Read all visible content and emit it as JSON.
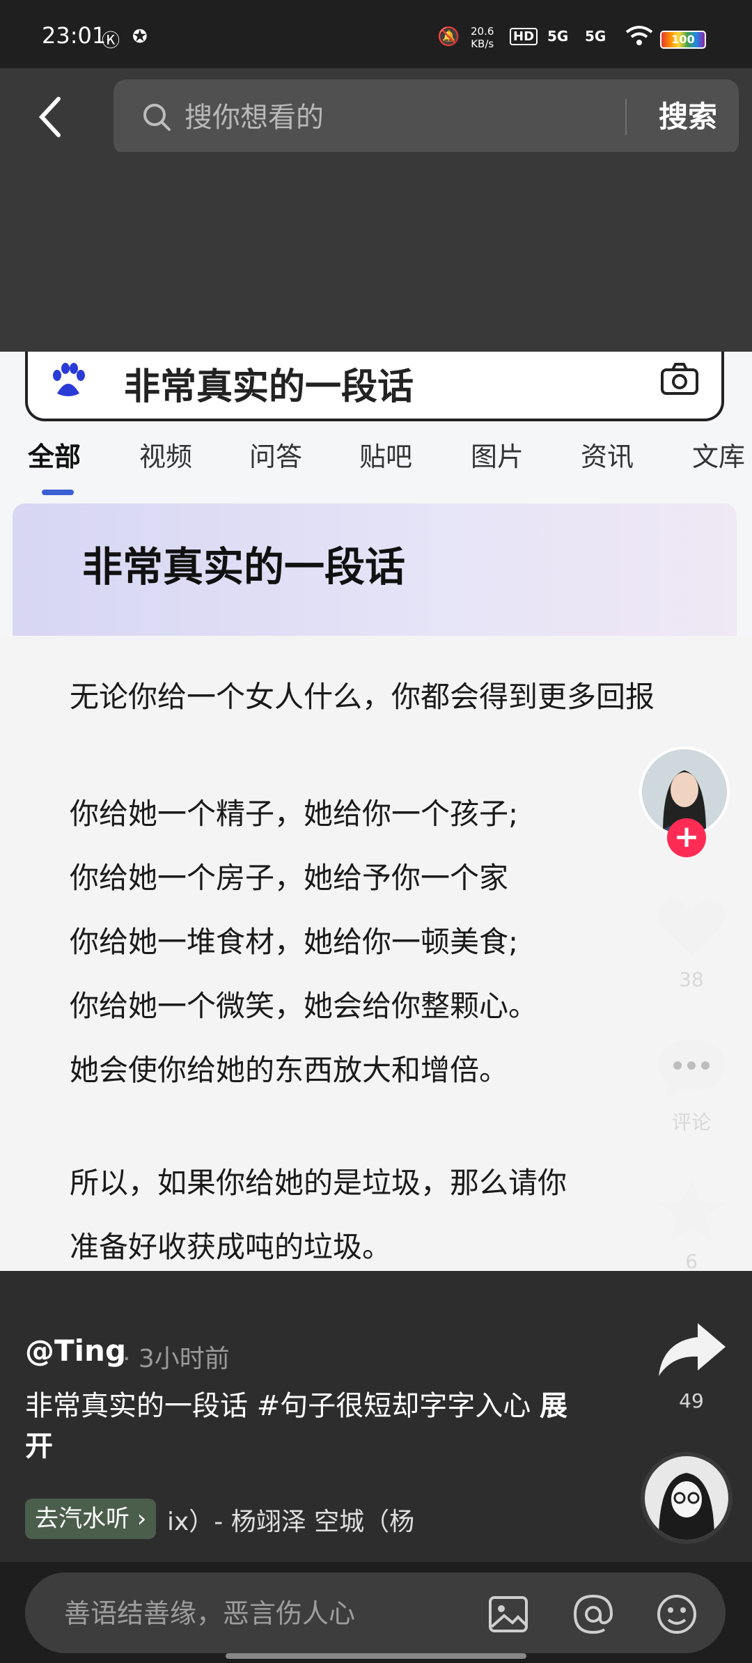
{
  "status_bar": {
    "time": "23:01",
    "speed_value": "20.6",
    "speed_unit": "KB/s",
    "hd_label": "HD",
    "net1": "5G",
    "net2": "5G",
    "battery": "100"
  },
  "search": {
    "placeholder": "搜你想看的",
    "button_label": "搜索"
  },
  "embedded": {
    "query": "非常真实的一段话",
    "tabs": [
      "全部",
      "视频",
      "问答",
      "贴吧",
      "图片",
      "资讯",
      "文库"
    ],
    "card_title": "非常真实的一段话",
    "lines": [
      "无论你给一个女人什么，你都会得到更多回报",
      "你给她一个精子，她给你一个孩子;",
      "你给她一个房子，她给予你一个家",
      "你给她一堆食材，她给你一顿美食;",
      "你给她一个微笑，她会给你整颗心。",
      "她会使你给她的东西放大和增倍。",
      "所以，如果你给她的是垃圾，那么请你",
      "准备好收获成吨的垃圾。"
    ]
  },
  "actions": {
    "likes": "38",
    "comments": "评论",
    "favorites": "6",
    "shares": "49"
  },
  "post": {
    "author": "@Ting",
    "time_ago": "· 3小时前",
    "description": "非常真实的一段话 #句子很短却字字入心",
    "expand_label": "展开",
    "music_link": "去汽水听 ›",
    "music_title": "ix）- 杨翊泽  空城（杨"
  },
  "comment": {
    "placeholder": "善语结善缘，恶言伤人心"
  },
  "colors": {
    "accent": "#fe2c55",
    "tab_indicator": "#3c5fd4"
  }
}
